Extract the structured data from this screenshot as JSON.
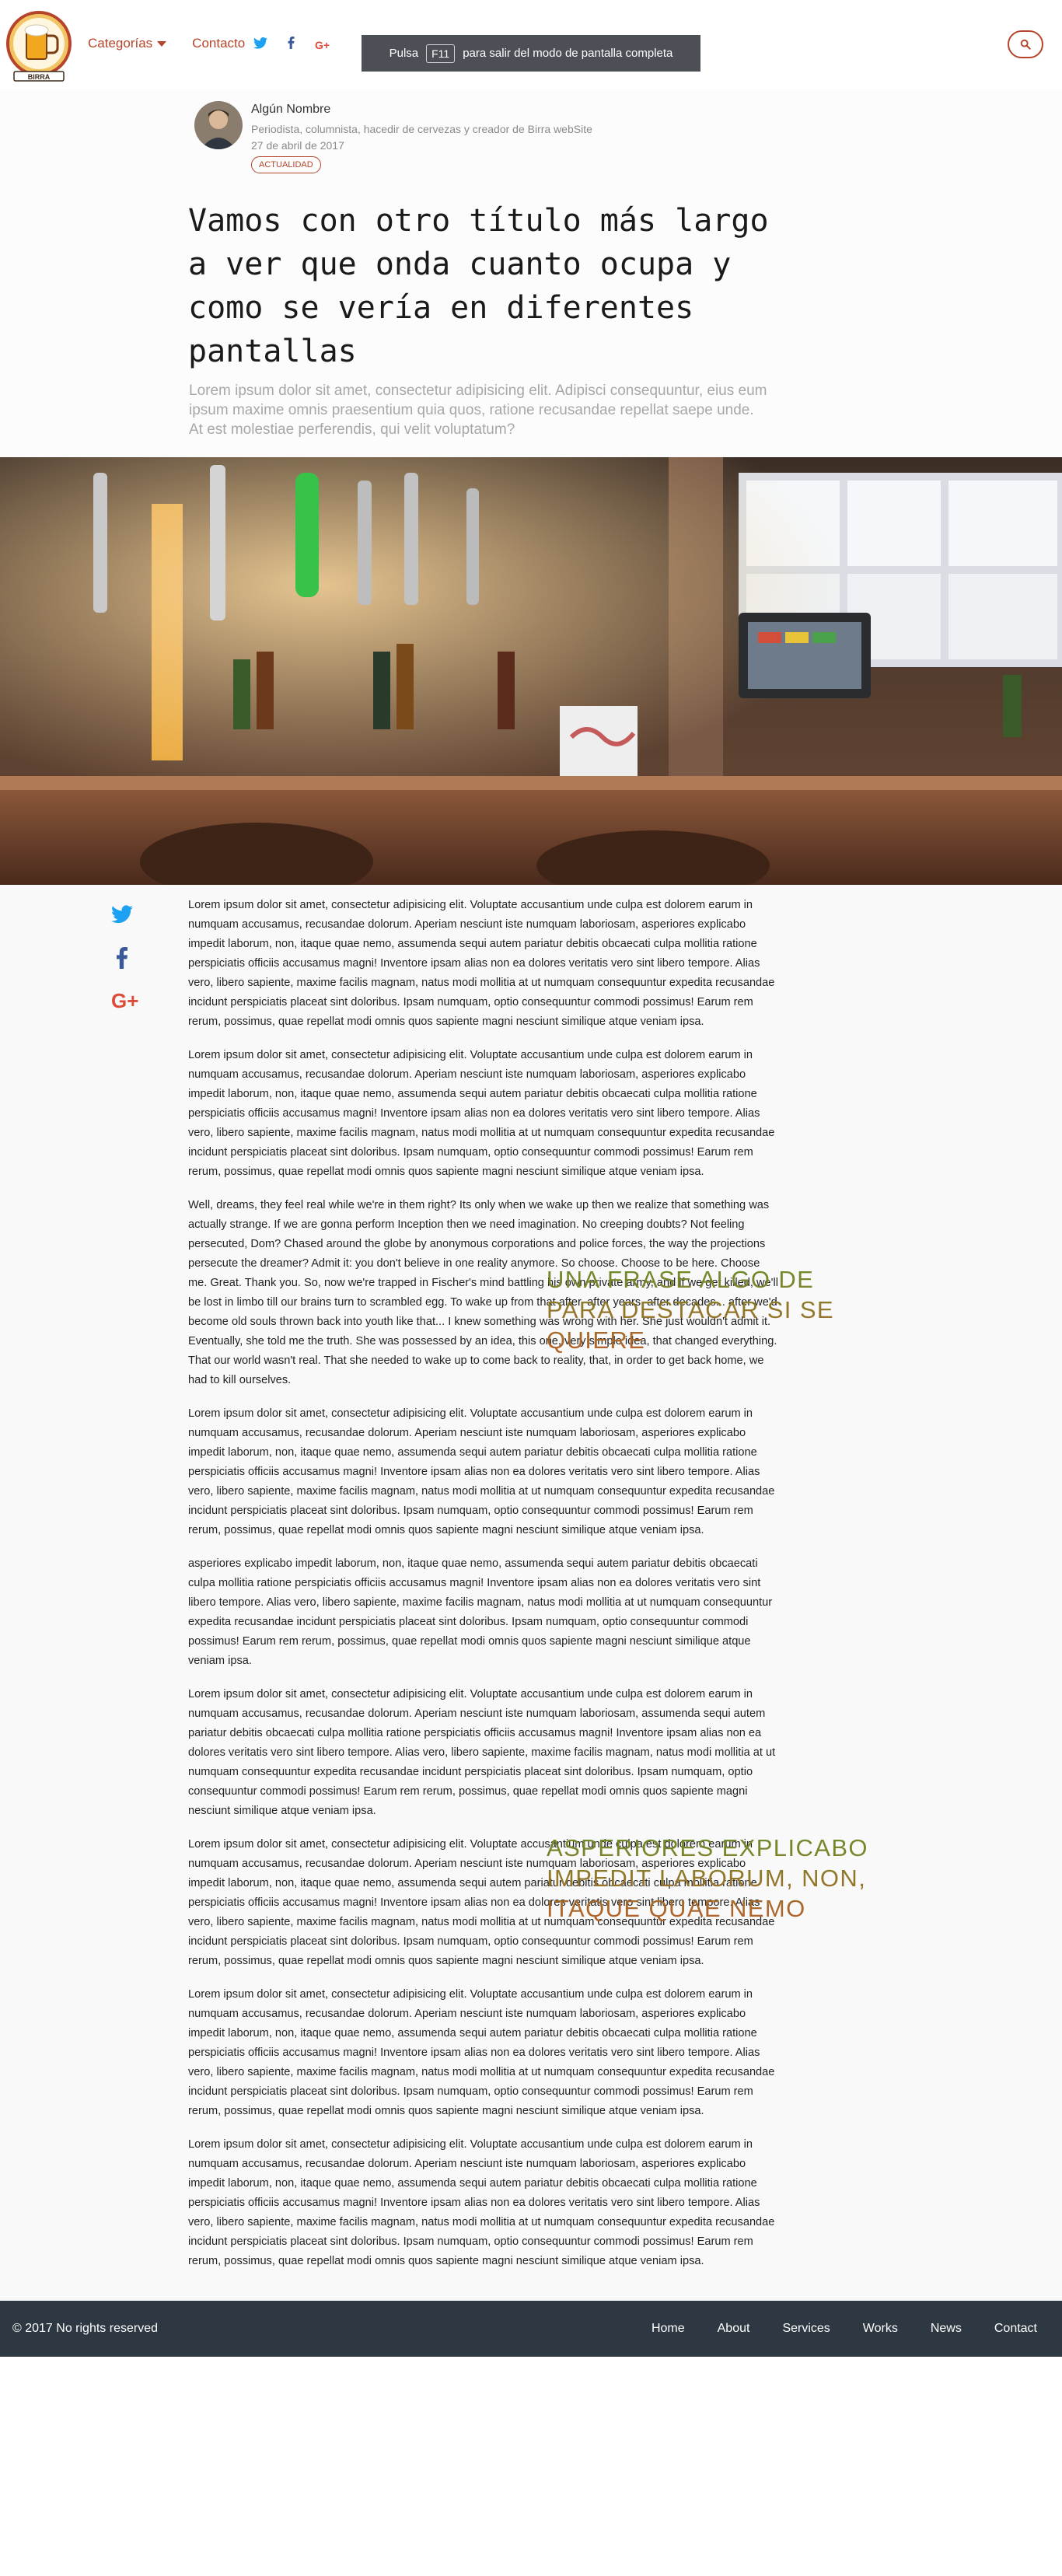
{
  "header": {
    "logo_text": "BIRRA",
    "nav": [
      {
        "label": "Categorías",
        "has_dropdown": true
      },
      {
        "label": "Contacto",
        "has_dropdown": false
      }
    ],
    "social": [
      "twitter-icon",
      "facebook-icon",
      "google-plus-icon"
    ],
    "fullscreen_banner": {
      "before": "Pulsa",
      "key": "F11",
      "after": "para salir del modo de pantalla completa"
    },
    "search_icon": "search-icon"
  },
  "author": {
    "name": "Algún Nombre",
    "bio": "Periodista, columnista, hacedir de cervezas y creador de Birra webSite",
    "date": "27 de abril de 2017",
    "tag": "ACTUALIDAD"
  },
  "article": {
    "title": "Vamos con otro título más largo a ver que onda cuanto ocupa y como se vería en diferentes pantallas",
    "lead": "Lorem ipsum dolor sit amet, consectetur adipisicing elit. Adipisci consequuntur, eius eum ipsum maxime omnis praesentium quia quos, ratione recusandae repellat saepe unde. At est molestiae perferendis, qui velit voluptatum?",
    "share": [
      "twitter-icon",
      "facebook-icon",
      "google-plus-icon"
    ],
    "paragraphs": [
      "Lorem ipsum dolor sit amet, consectetur adipisicing elit. Voluptate accusantium unde culpa est dolorem earum in numquam accusamus, recusandae dolorum. Aperiam nesciunt iste numquam laboriosam, asperiores explicabo impedit laborum, non, itaque quae nemo, assumenda sequi autem pariatur debitis obcaecati culpa mollitia ratione perspiciatis officiis accusamus magni! Inventore ipsam alias non ea dolores veritatis vero sint libero tempore. Alias vero, libero sapiente, maxime facilis magnam, natus modi mollitia at ut numquam consequuntur expedita recusandae incidunt perspiciatis placeat sint doloribus. Ipsam numquam, optio consequuntur commodi possimus! Earum rem rerum, possimus, quae repellat modi omnis quos sapiente magni nesciunt similique atque veniam ipsa.",
      "Lorem ipsum dolor sit amet, consectetur adipisicing elit. Voluptate accusantium unde culpa est dolorem earum in numquam accusamus, recusandae dolorum. Aperiam nesciunt iste numquam laboriosam, asperiores explicabo impedit laborum, non, itaque quae nemo, assumenda sequi autem pariatur debitis obcaecati culpa mollitia ratione perspiciatis officiis accusamus magni! Inventore ipsam alias non ea dolores veritatis vero sint libero tempore. Alias vero, libero sapiente, maxime facilis magnam, natus modi mollitia at ut numquam consequuntur expedita recusandae incidunt perspiciatis placeat sint doloribus. Ipsam numquam, optio consequuntur commodi possimus! Earum rem rerum, possimus, quae repellat modi omnis quos sapiente magni nesciunt similique atque veniam ipsa.",
      "Well, dreams, they feel real while we're in them right? Its only when we wake up then we realize that something was actually strange. If we are gonna perform Inception then we need imagination. No creeping doubts? Not feeling persecuted, Dom? Chased around the globe by anonymous corporations and police forces, the way the projections persecute the dreamer? Admit it: you don't believe in one reality anymore. So choose. Choose to be here. Choose me. Great. Thank you. So, now we're trapped in Fischer's mind battling his own private army, and if we get killed, we'll be lost in limbo till our brains turn to scrambled egg. To wake up from that after, after years, after decades... after we'd become old souls thrown back into youth like that... I knew something was wrong with her. She just wouldn't admit it. Eventually, she told me the truth. She was possessed by an idea, this one, very simple idea, that changed everything. That our world wasn't real. That she needed to wake up to come back to reality, that, in order to get back home, we had to kill ourselves.",
      "Lorem ipsum dolor sit amet, consectetur adipisicing elit. Voluptate accusantium unde culpa est dolorem earum in numquam accusamus, recusandae dolorum. Aperiam nesciunt iste numquam laboriosam, asperiores explicabo impedit laborum, non, itaque quae nemo, assumenda sequi autem pariatur debitis obcaecati culpa mollitia ratione perspiciatis officiis accusamus magni! Inventore ipsam alias non ea dolores veritatis vero sint libero tempore. Alias vero, libero sapiente, maxime facilis magnam, natus modi mollitia at ut numquam consequuntur expedita recusandae incidunt perspiciatis placeat sint doloribus. Ipsam numquam, optio consequuntur commodi possimus! Earum rem rerum, possimus, quae repellat modi omnis quos sapiente magni nesciunt similique atque veniam ipsa.",
      "asperiores explicabo impedit laborum, non, itaque quae nemo, assumenda sequi autem pariatur debitis obcaecati culpa mollitia ratione perspiciatis officiis accusamus magni! Inventore ipsam alias non ea dolores veritatis vero sint libero tempore. Alias vero, libero sapiente, maxime facilis magnam, natus modi mollitia at ut numquam consequuntur expedita recusandae incidunt perspiciatis placeat sint doloribus. Ipsam numquam, optio consequuntur commodi possimus! Earum rem rerum, possimus, quae repellat modi omnis quos sapiente magni nesciunt similique atque veniam ipsa.",
      "Lorem ipsum dolor sit amet, consectetur adipisicing elit. Voluptate accusantium unde culpa est dolorem earum in numquam accusamus, recusandae dolorum. Aperiam nesciunt iste numquam laboriosam, assumenda sequi autem pariatur debitis obcaecati culpa mollitia ratione perspiciatis officiis accusamus magni! Inventore ipsam alias non ea dolores veritatis vero sint libero tempore. Alias vero, libero sapiente, maxime facilis magnam, natus modi mollitia at ut numquam consequuntur expedita recusandae incidunt perspiciatis placeat sint doloribus. Ipsam numquam, optio consequuntur commodi possimus! Earum rem rerum, possimus, quae repellat modi omnis quos sapiente magni nesciunt similique atque veniam ipsa.",
      "Lorem ipsum dolor sit amet, consectetur adipisicing elit. Voluptate accusantium unde culpa est dolorem earum in numquam accusamus, recusandae dolorum. Aperiam nesciunt iste numquam laboriosam, asperiores explicabo impedit laborum, non, itaque quae nemo, assumenda sequi autem pariatur debitis obcaecati culpa mollitia ratione perspiciatis officiis accusamus magni! Inventore ipsam alias non ea dolores veritatis vero sint libero tempore. Alias vero, libero sapiente, maxime facilis magnam, natus modi mollitia at ut numquam consequuntur expedita recusandae incidunt perspiciatis placeat sint doloribus. Ipsam numquam, optio consequuntur commodi possimus! Earum rem rerum, possimus, quae repellat modi omnis quos sapiente magni nesciunt similique atque veniam ipsa.",
      "Lorem ipsum dolor sit amet, consectetur adipisicing elit. Voluptate accusantium unde culpa est dolorem earum in numquam accusamus, recusandae dolorum. Aperiam nesciunt iste numquam laboriosam, asperiores explicabo impedit laborum, non, itaque quae nemo, assumenda sequi autem pariatur debitis obcaecati culpa mollitia ratione perspiciatis officiis accusamus magni! Inventore ipsam alias non ea dolores veritatis vero sint libero tempore. Alias vero, libero sapiente, maxime facilis magnam, natus modi mollitia at ut numquam consequuntur expedita recusandae incidunt perspiciatis placeat sint doloribus. Ipsam numquam, optio consequuntur commodi possimus! Earum rem rerum, possimus, quae repellat modi omnis quos sapiente magni nesciunt similique atque veniam ipsa.",
      "Lorem ipsum dolor sit amet, consectetur adipisicing elit. Voluptate accusantium unde culpa est dolorem earum in numquam accusamus, recusandae dolorum. Aperiam nesciunt iste numquam laboriosam, asperiores explicabo impedit laborum, non, itaque quae nemo, assumenda sequi autem pariatur debitis obcaecati culpa mollitia ratione perspiciatis officiis accusamus magni! Inventore ipsam alias non ea dolores veritatis vero sint libero tempore. Alias vero, libero sapiente, maxime facilis magnam, natus modi mollitia at ut numquam consequuntur expedita recusandae incidunt perspiciatis placeat sint doloribus. Ipsam numquam, optio consequuntur commodi possimus! Earum rem rerum, possimus, quae repellat modi omnis quos sapiente magni nesciunt similique atque veniam ipsa."
    ],
    "pullquotes": [
      "UNA FRASE ALGO DE PARA DESTACAR SI SE QUIERE",
      "ASPERIORES EXPLICABO IMPEDIT LABORUM, NON, ITAQUE QUAE NEMO"
    ]
  },
  "footer": {
    "copyright": "© 2017 No rights reserved",
    "links": [
      "Home",
      "About",
      "Services",
      "Works",
      "News",
      "Contact"
    ]
  },
  "colors": {
    "accent": "#b5442a",
    "footer_bg": "#2e3842",
    "banner_bg": "#4c4f56",
    "quote_top": "#6a8e2a",
    "quote_bottom": "#b8602b",
    "twitter": "#1da1f2",
    "facebook": "#3b5998",
    "google_plus": "#dd4b39"
  }
}
